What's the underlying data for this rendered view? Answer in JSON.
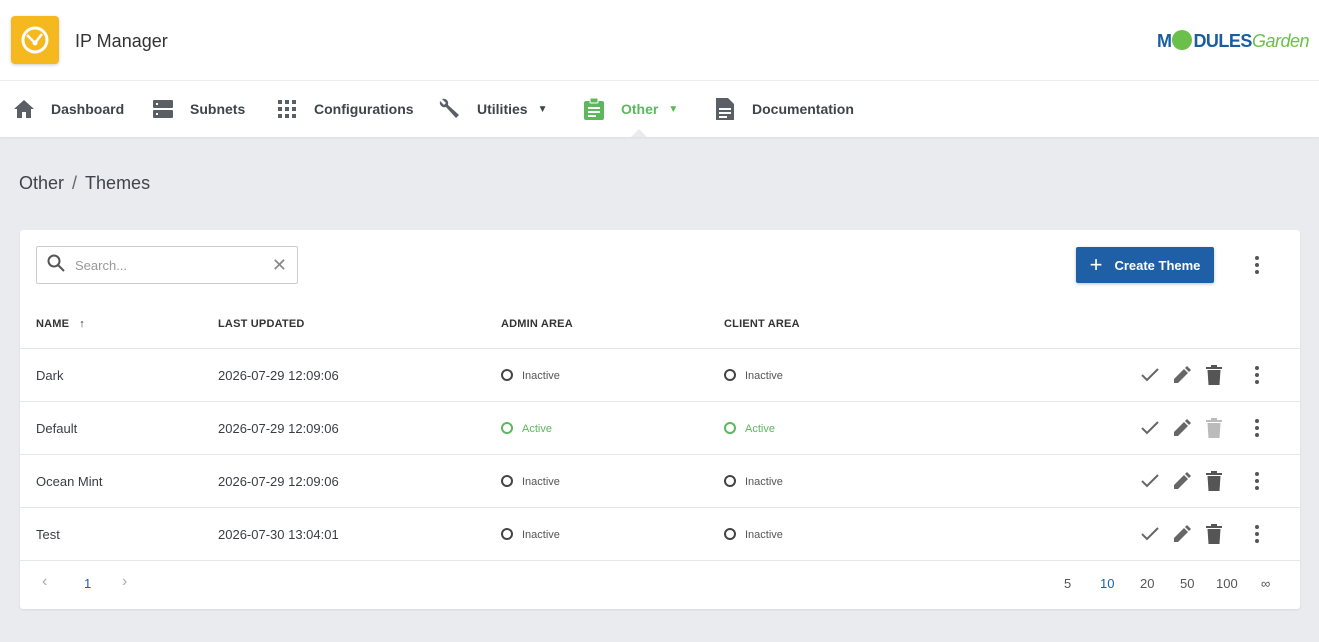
{
  "app": {
    "title": "IP Manager",
    "brand_main": "M",
    "brand_mid": "DULES",
    "brand_tail": "Garden"
  },
  "nav": {
    "dashboard": "Dashboard",
    "subnets": "Subnets",
    "configurations": "Configurations",
    "utilities": "Utilities",
    "other": "Other",
    "documentation": "Documentation"
  },
  "breadcrumb": {
    "parent": "Other",
    "separator": "/",
    "current": "Themes"
  },
  "search": {
    "placeholder": "Search..."
  },
  "toolbar": {
    "create_label": "Create Theme"
  },
  "table": {
    "headers": {
      "name": "NAME",
      "sort": "↑",
      "updated": "LAST UPDATED",
      "admin": "ADMIN AREA",
      "client": "CLIENT AREA"
    },
    "rows": [
      {
        "name": "Dark",
        "updated": "2026-07-29 12:09:06",
        "admin": "Inactive",
        "client": "Inactive"
      },
      {
        "name": "Default",
        "updated": "2026-07-29 12:09:06",
        "admin": "Active",
        "client": "Active"
      },
      {
        "name": "Ocean Mint",
        "updated": "2026-07-29 12:09:06",
        "admin": "Inactive",
        "client": "Inactive"
      },
      {
        "name": "Test",
        "updated": "2026-07-30 13:04:01",
        "admin": "Inactive",
        "client": "Inactive"
      }
    ]
  },
  "pagination": {
    "prev": "‹",
    "page": "1",
    "next": "›",
    "sizes": [
      "5",
      "10",
      "20",
      "50",
      "100",
      "∞"
    ],
    "selected_size": "10"
  },
  "colors": {
    "accent": "#1f5fa6",
    "active": "#5cb85c",
    "logo": "#f5b81e"
  },
  "icons": [
    "app-logo-icon",
    "home-icon",
    "server-icon",
    "grid-icon",
    "wrench-icon",
    "clipboard-icon",
    "document-icon",
    "search-icon",
    "close-icon",
    "plus-icon",
    "check-icon",
    "pencil-icon",
    "trash-icon",
    "more-vertical-icon"
  ]
}
